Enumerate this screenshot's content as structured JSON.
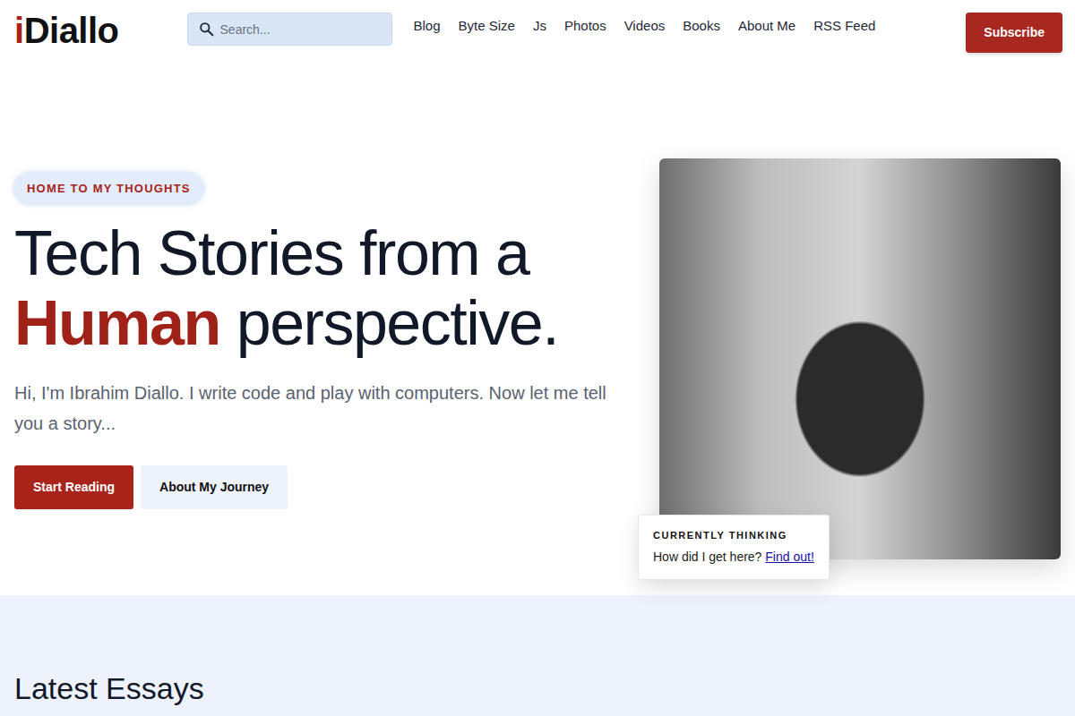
{
  "logo": {
    "prefix": "i",
    "name": "Diallo"
  },
  "search": {
    "placeholder": "Search..."
  },
  "nav": [
    "Blog",
    "Byte Size",
    "Js",
    "Photos",
    "Videos",
    "Books",
    "About Me",
    "RSS Feed"
  ],
  "subscribe": "Subscribe",
  "hero": {
    "badge": "HOME TO MY THOUGHTS",
    "title_line1": "Tech Stories from a",
    "title_highlight": "Human",
    "title_rest": "perspective.",
    "intro": "Hi, I'm Ibrahim Diallo. I write code and play with computers. Now let me tell you a story...",
    "buttons": [
      {
        "label": "Start Reading",
        "kind": "primary"
      },
      {
        "label": "About My Journey",
        "kind": "secondary"
      }
    ]
  },
  "photo_card": {
    "label": "CURRENTLY THINKING",
    "text": "How did I get here?",
    "link": "Find out!"
  },
  "latest": {
    "title": "Latest Essays"
  }
}
